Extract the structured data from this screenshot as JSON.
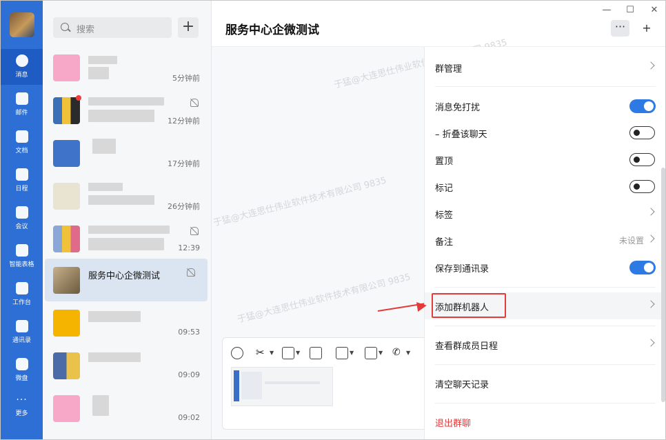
{
  "window": {
    "minimize": "—",
    "maximize": "☐",
    "close": "✕"
  },
  "nav": {
    "items": [
      {
        "label": "消息",
        "icon": "message-icon"
      },
      {
        "label": "邮件",
        "icon": "mail-icon"
      },
      {
        "label": "文档",
        "icon": "document-icon"
      },
      {
        "label": "日程",
        "icon": "calendar-icon"
      },
      {
        "label": "会议",
        "icon": "meeting-icon"
      },
      {
        "label": "智能表格",
        "icon": "smart-sheet-icon"
      },
      {
        "label": "工作台",
        "icon": "workbench-icon"
      },
      {
        "label": "通讯录",
        "icon": "contacts-icon"
      },
      {
        "label": "微盘",
        "icon": "drive-icon"
      },
      {
        "label": "更多",
        "icon": "more-icon"
      }
    ]
  },
  "search": {
    "placeholder": "搜索",
    "add": "+"
  },
  "conversations": [
    {
      "time": "5分钟前"
    },
    {
      "time": "12分钟前",
      "muted": true,
      "unread": true
    },
    {
      "time": "17分钟前"
    },
    {
      "time": "26分钟前"
    },
    {
      "time": "12:39",
      "muted": true
    },
    {
      "name": "服务中心企微测试",
      "muted": true,
      "active": true
    },
    {
      "time": "09:53"
    },
    {
      "time": "09:09"
    },
    {
      "time": "09:02"
    }
  ],
  "chat": {
    "title": "服务中心企微测试",
    "more": "···",
    "add_member": "+",
    "watermarks": [
      "于猛@大连思仕伟业软件技术有限公司 9835",
      "于猛@大连思仕伟业软件技术有限公司 9835",
      "于猛@大连思仕伟业软件技术有限公司 9835"
    ]
  },
  "panel": {
    "rows": [
      {
        "label": "群管理",
        "type": "chevron"
      },
      {
        "label": "消息免打扰",
        "type": "toggle",
        "on": true
      },
      {
        "label": "– 折叠该聊天",
        "type": "toggle",
        "on": false
      },
      {
        "label": "置顶",
        "type": "toggle",
        "on": false
      },
      {
        "label": "标记",
        "type": "toggle",
        "on": false
      },
      {
        "label": "标签",
        "type": "chevron"
      },
      {
        "label": "备注",
        "type": "chevron",
        "value": "未设置"
      },
      {
        "label": "保存到通讯录",
        "type": "toggle",
        "on": true
      },
      {
        "label": "添加群机器人",
        "type": "chevron",
        "highlight": true
      },
      {
        "label": "查看群成员日程",
        "type": "chevron"
      },
      {
        "label": "清空聊天记录",
        "type": "none"
      },
      {
        "label": "退出群聊",
        "type": "none",
        "danger": true
      }
    ]
  },
  "colors": {
    "accent": "#2e7ae5",
    "nav_bg": "#2d6fd5",
    "danger": "#e33a3a"
  }
}
